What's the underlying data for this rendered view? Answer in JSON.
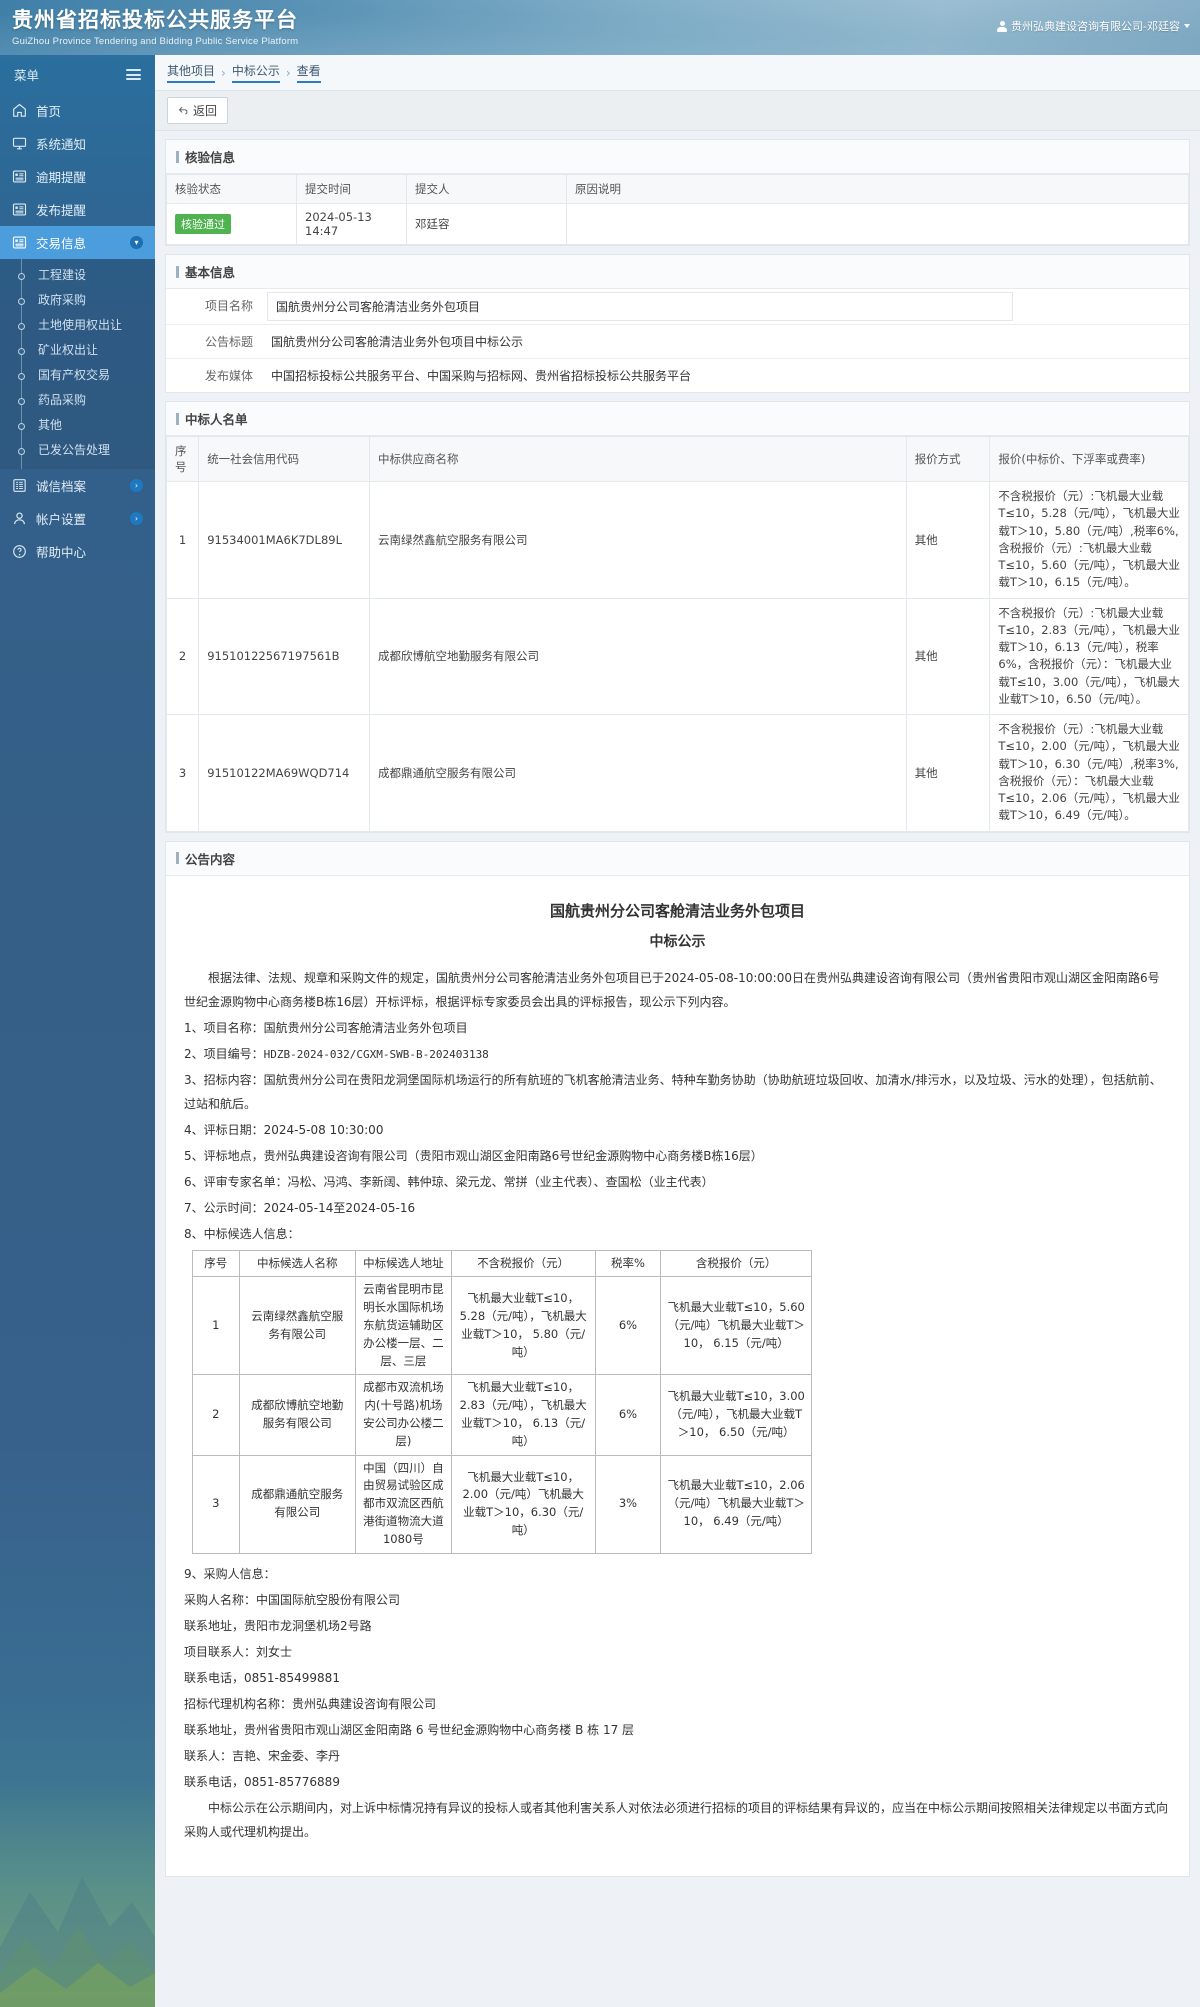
{
  "header": {
    "title_cn": "贵州省招标投标公共服务平台",
    "title_en": "GuiZhou Province Tendering and Bidding Public Service Platform",
    "user": "贵州弘典建设咨询有限公司-邓廷容"
  },
  "sidebar": {
    "menu_label": "菜单",
    "items": [
      {
        "label": "首页",
        "icon": "home-icon",
        "active": false
      },
      {
        "label": "系统通知",
        "icon": "monitor-icon",
        "active": false
      },
      {
        "label": "逾期提醒",
        "icon": "list-icon",
        "active": false
      },
      {
        "label": "发布提醒",
        "icon": "list-icon",
        "active": false
      },
      {
        "label": "交易信息",
        "icon": "list-icon",
        "active": true
      }
    ],
    "sub_items": [
      {
        "label": "工程建设"
      },
      {
        "label": "政府采购"
      },
      {
        "label": "土地使用权出让"
      },
      {
        "label": "矿业权出让"
      },
      {
        "label": "国有产权交易"
      },
      {
        "label": "药品采购"
      },
      {
        "label": "其他"
      },
      {
        "label": "已发公告处理"
      }
    ],
    "items_bottom": [
      {
        "label": "诚信档案",
        "icon": "archive-icon"
      },
      {
        "label": "帐户设置",
        "icon": "user-icon"
      },
      {
        "label": "帮助中心",
        "icon": "help-icon"
      }
    ]
  },
  "breadcrumb": {
    "item1": "其他项目",
    "sep1": "›",
    "item2": "中标公示",
    "sep2": "›",
    "item3": "查看"
  },
  "toolbar": {
    "back_label": "返回"
  },
  "verify": {
    "panel_title": "核验信息",
    "headers": [
      "核验状态",
      "提交时间",
      "提交人",
      "原因说明"
    ],
    "row": {
      "status": "核验通过",
      "time": "2024-05-13 14:47",
      "person": "邓廷容",
      "reason": ""
    }
  },
  "basic": {
    "panel_title": "基本信息",
    "rows": [
      {
        "label": "项目名称",
        "value": "国航贵州分公司客舱清洁业务外包项目",
        "boxed": true
      },
      {
        "label": "公告标题",
        "value": "国航贵州分公司客舱清洁业务外包项目中标公示",
        "boxed": false
      },
      {
        "label": "发布媒体",
        "value": "中国招标投标公共服务平台、中国采购与招标网、贵州省招标投标公共服务平台",
        "boxed": false
      }
    ]
  },
  "winners": {
    "panel_title": "中标人名单",
    "headers": [
      "序号",
      "统一社会信用代码",
      "中标供应商名称",
      "报价方式",
      "报价(中标价、下浮率或费率)"
    ],
    "rows": [
      {
        "no": "1",
        "code": "91534001MA6K7DL89L",
        "name": "云南绿然鑫航空服务有限公司",
        "method": "其他",
        "price": "不含税报价（元）:飞机最大业载T≤10，5.28（元/吨），飞机最大业载T＞10，5.80（元/吨）,税率6%,含税报价（元）:飞机最大业载T≤10，5.60（元/吨），飞机最大业载T＞10，6.15（元/吨）。"
      },
      {
        "no": "2",
        "code": "91510122567197561B",
        "name": "成都欣博航空地勤服务有限公司",
        "method": "其他",
        "price": "不含税报价（元）:飞机最大业载T≤10，2.83（元/吨），飞机最大业载T＞10，6.13（元/吨），税率6%，含税报价（元）：飞机最大业载T≤10，3.00（元/吨），飞机最大业载T＞10，6.50（元/吨）。"
      },
      {
        "no": "3",
        "code": "91510122MA69WQD714",
        "name": "成都鼎通航空服务有限公司",
        "method": "其他",
        "price": "不含税报价（元）:飞机最大业载T≤10，2.00（元/吨），飞机最大业载T＞10，6.30（元/吨）,税率3%,含税报价（元）：飞机最大业载T≤10，2.06（元/吨），飞机最大业载T＞10，6.49（元/吨）。"
      }
    ]
  },
  "announcement": {
    "panel_title": "公告内容",
    "title": "国航贵州分公司客舱清洁业务外包项目",
    "subtitle": "中标公示",
    "intro": "根据法律、法规、规章和采购文件的规定，国航贵州分公司客舱清洁业务外包项目已于2024-05-08-10:00:00日在贵州弘典建设咨询有限公司（贵州省贵阳市观山湖区金阳南路6号世纪金源购物中心商务楼B栋16层）开标评标，根据评标专家委员会出具的评标报告，现公示下列内容。",
    "line1": "1、项目名称：国航贵州分公司客舱清洁业务外包项目",
    "line2_label": "2、项目编号：",
    "line2_value": "HDZB-2024-032/CGXM-SWB-B-202403138",
    "line3": "3、招标内容：国航贵州分公司在贵阳龙洞堡国际机场运行的所有航班的飞机客舱清洁业务、特种车勤务协助（协助航班垃圾回收、加清水/排污水，以及垃圾、污水的处理），包括航前、过站和航后。",
    "line4": "4、评标日期：2024-5-08   10:30:00",
    "line5": "5、评标地点，贵州弘典建设咨询有限公司（贵阳市观山湖区金阳南路6号世纪金源购物中心商务楼B栋16层）",
    "line6": "6、评审专家名单：冯松、冯鸿、李新阔、韩仲琼、梁元龙、常拼（业主代表）、查国松（业主代表）",
    "line7": "7、公示时间：2024-05-14至2024-05-16",
    "line8": "8、中标候选人信息：",
    "line9": "9、采购人信息：",
    "buyer_name": "采购人名称：中国国际航空股份有限公司",
    "buyer_addr": "联系地址，贵阳市龙洞堡机场2号路",
    "buyer_contact": "项目联系人：刘女士",
    "buyer_phone": "联系电话，0851-85499881",
    "agent_name": "招标代理机构名称：贵州弘典建设咨询有限公司",
    "agent_addr": "联系地址，贵州省贵阳市观山湖区金阳南路 6 号世纪金源购物中心商务楼 B 栋 17 层",
    "agent_contact": "联系人：吉艳、宋金委、李丹",
    "agent_phone": "联系电话，0851-85776889",
    "footer": "中标公示在公示期间内，对上诉中标情况持有异议的投标人或者其他利害关系人对依法必须进行招标的项目的评标结果有异议的，应当在中标公示期间按照相关法律规定以书面方式向采购人或代理机构提出。",
    "candidate_table": {
      "headers": [
        "序号",
        "中标候选人名称",
        "中标候选人地址",
        "不含税报价（元）",
        "税率%",
        "含税报价（元）"
      ],
      "rows": [
        {
          "no": "1",
          "name": "云南绿然鑫航空服务有限公司",
          "addr": "云南省昆明市昆明长水国际机场东航货运辅助区办公楼一层、二层、三层",
          "price_excl": "飞机最大业载T≤10，5.28（元/吨），飞机最大业载T＞10， 5.80（元/吨）",
          "tax": "6%",
          "price_incl": "飞机最大业载T≤10，5.60（元/吨）飞机最大业载T＞10， 6.15（元/吨）"
        },
        {
          "no": "2",
          "name": "成都欣博航空地勤服务有限公司",
          "addr": "成都市双流机场内(十号路)机场安公司办公楼二层)",
          "price_excl": "飞机最大业载T≤10，2.83（元/吨），飞机最大业载T＞10， 6.13（元/吨）",
          "tax": "6%",
          "price_incl": "飞机最大业载T≤10，3.00（元/吨），飞机最大业载T＞10， 6.50（元/吨）"
        },
        {
          "no": "3",
          "name": "成都鼎通航空服务有限公司",
          "addr": "中国（四川）自由贸易试验区成都市双流区西航港街道物流大道1080号",
          "price_excl": "飞机最大业载T≤10，2.00（元/吨）飞机最大业载T＞10，6.30（元/吨）",
          "tax": "3%",
          "price_incl": "飞机最大业载T≤10，2.06（元/吨）飞机最大业载T＞10， 6.49（元/吨）"
        }
      ]
    }
  }
}
